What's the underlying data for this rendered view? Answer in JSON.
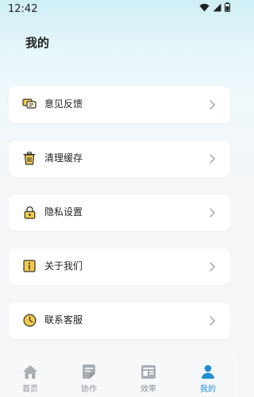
{
  "status_bar": {
    "time": "12:42",
    "icons": [
      "wifi-icon",
      "signal-icon",
      "battery-icon"
    ]
  },
  "page": {
    "title": "我的"
  },
  "menu": {
    "items": [
      {
        "label": "意见反馈",
        "icon": "feedback-chat-icon"
      },
      {
        "label": "清理缓存",
        "icon": "trash-icon"
      },
      {
        "label": "隐私设置",
        "icon": "lock-icon"
      },
      {
        "label": "关于我们",
        "icon": "info-icon"
      },
      {
        "label": "联系客服",
        "icon": "clock-icon"
      }
    ]
  },
  "tabbar": {
    "items": [
      {
        "label": "首页",
        "icon": "home-icon",
        "active": false
      },
      {
        "label": "协作",
        "icon": "collaborate-icon",
        "active": false
      },
      {
        "label": "效率",
        "icon": "efficiency-icon",
        "active": false
      },
      {
        "label": "我的",
        "icon": "profile-icon",
        "active": true
      }
    ]
  },
  "colors": {
    "accent": "#1f8fd0",
    "icon_yellow": "#f2c94c",
    "inactive_tab": "#8a8f96"
  }
}
